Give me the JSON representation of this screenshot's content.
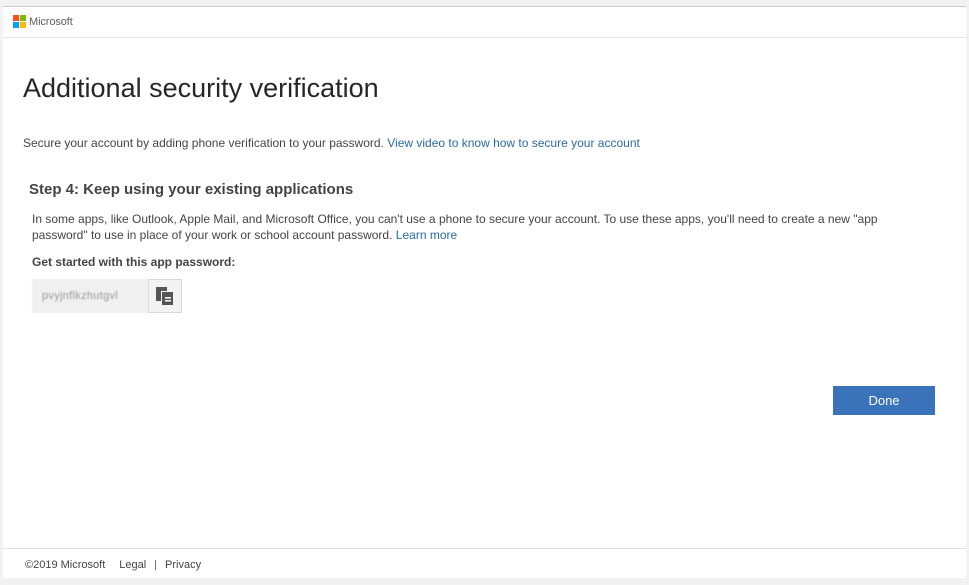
{
  "header": {
    "logo_text": "Microsoft",
    "logo_colors": [
      "#f25022",
      "#7fba00",
      "#00a4ef",
      "#ffb900"
    ]
  },
  "page": {
    "title": "Additional security verification",
    "intro_text": "Secure your account by adding phone verification to your password.",
    "intro_link": "View video to know how to secure your account"
  },
  "step": {
    "title": "Step 4: Keep using your existing applications",
    "description": "In some apps, like Outlook, Apple Mail, and Microsoft Office, you can't use a phone to secure your account. To use these apps, you'll need to create a new \"app password\" to use in place of your work or school account password.",
    "learn_more": "Learn more",
    "get_started_label": "Get started with this app password:",
    "app_password": "pvyjnflkzhutgvl"
  },
  "actions": {
    "done_label": "Done",
    "done_color": "#3a73b9"
  },
  "footer": {
    "copyright": "©2019 Microsoft",
    "legal": "Legal",
    "separator": "|",
    "privacy": "Privacy"
  }
}
